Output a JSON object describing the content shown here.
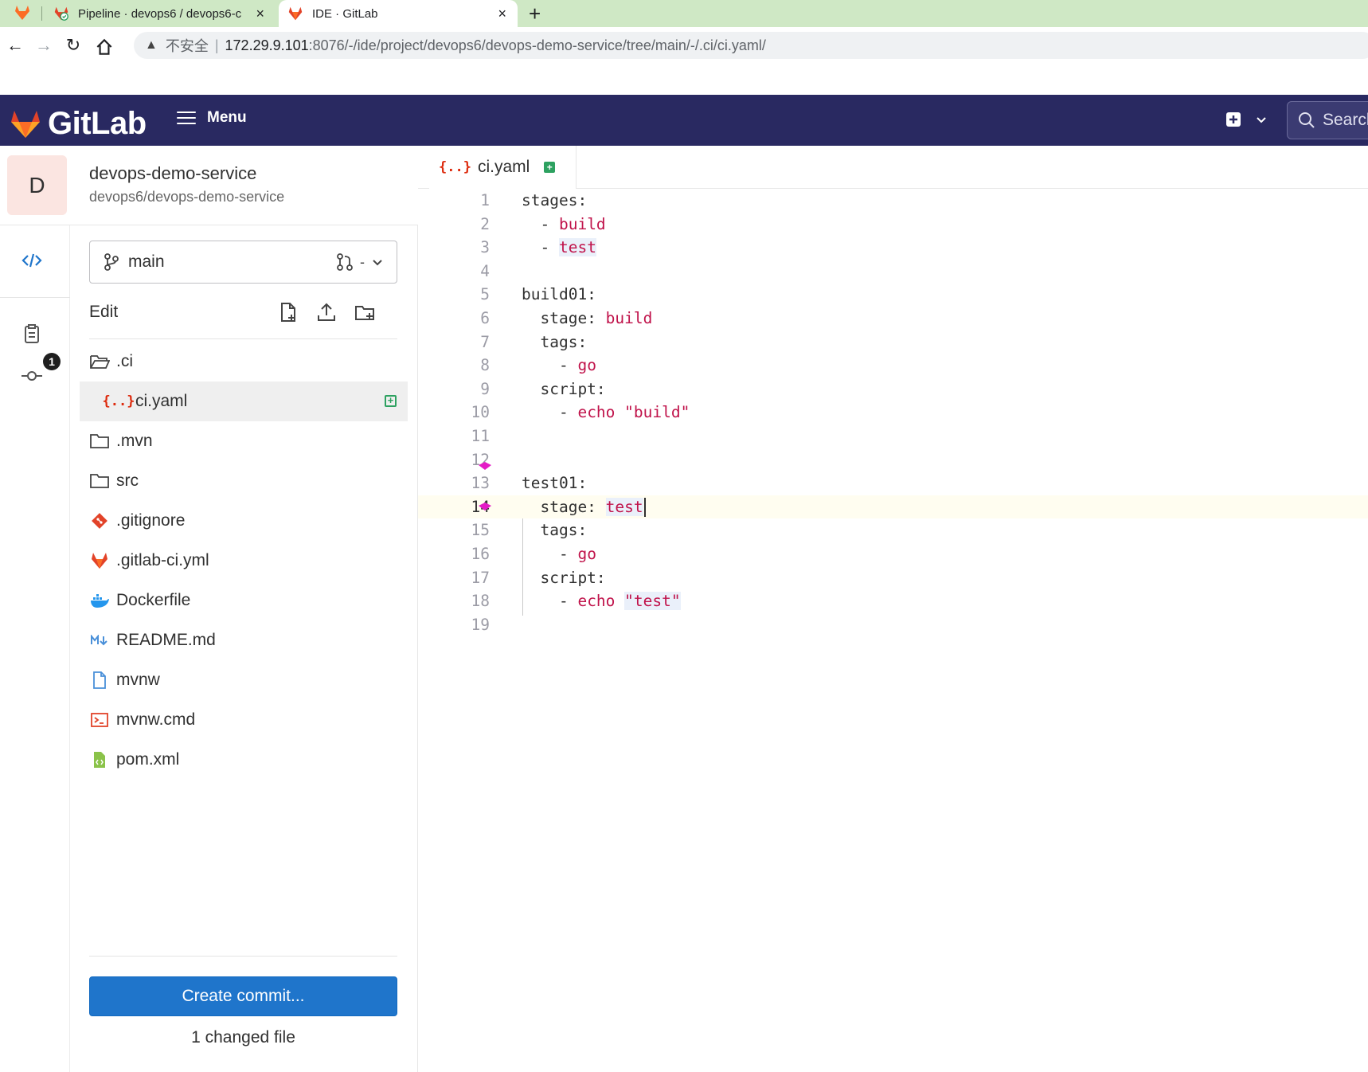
{
  "browser": {
    "tabs": [
      {
        "title": "Pipeline · devops6 / devops6-c",
        "close": "×"
      },
      {
        "title": "IDE · GitLab",
        "close": "×"
      }
    ],
    "new_tab": "+",
    "address": {
      "warning_icon": "warning-triangle-icon",
      "insecure_label": "不安全",
      "separator": "|",
      "host": "172.29.9.101",
      "path": ":8076/-/ide/project/devops6/devops-demo-service/tree/main/-/.ci/ci.yaml/"
    }
  },
  "header": {
    "brand": "GitLab",
    "menu_label": "Menu",
    "search_placeholder": "Search",
    "colors": {
      "background": "#292961",
      "brand_orange": "#e24329"
    }
  },
  "project": {
    "avatar_letter": "D",
    "name": "devops-demo-service",
    "path": "devops6/devops-demo-service"
  },
  "sidebar": {
    "branch": "main",
    "mr_label": "-",
    "edit_label": "Edit",
    "commit_badge": "1",
    "files": [
      {
        "name": ".ci",
        "icon": "folder-open-icon",
        "type": "folder"
      },
      {
        "name": "ci.yaml",
        "icon": "yaml-icon",
        "type": "file",
        "active": true,
        "added": true
      },
      {
        "name": ".mvn",
        "icon": "folder-icon",
        "type": "folder"
      },
      {
        "name": "src",
        "icon": "folder-icon",
        "type": "folder"
      },
      {
        "name": ".gitignore",
        "icon": "git-icon",
        "type": "file"
      },
      {
        "name": ".gitlab-ci.yml",
        "icon": "gitlab-icon",
        "type": "file"
      },
      {
        "name": "Dockerfile",
        "icon": "docker-icon",
        "type": "file"
      },
      {
        "name": "README.md",
        "icon": "markdown-icon",
        "type": "file"
      },
      {
        "name": "mvnw",
        "icon": "file-icon",
        "type": "file"
      },
      {
        "name": "mvnw.cmd",
        "icon": "terminal-icon",
        "type": "file"
      },
      {
        "name": "pom.xml",
        "icon": "xml-icon",
        "type": "file"
      }
    ],
    "create_commit_label": "Create commit...",
    "changed_files_label": "1 changed file"
  },
  "editor": {
    "tab_label": "ci.yaml",
    "yaml_glyph": "{..}",
    "added_glyph": "+",
    "lines": [
      {
        "n": "1",
        "text": "stages:"
      },
      {
        "n": "2",
        "text": "  - build"
      },
      {
        "n": "3",
        "text": "  - test"
      },
      {
        "n": "4",
        "text": ""
      },
      {
        "n": "5",
        "text": "build01:"
      },
      {
        "n": "6",
        "text": "  stage: build"
      },
      {
        "n": "7",
        "text": "  tags:"
      },
      {
        "n": "8",
        "text": "    - go"
      },
      {
        "n": "9",
        "text": "  script:"
      },
      {
        "n": "10",
        "text": "    - echo \"build\""
      },
      {
        "n": "11",
        "text": ""
      },
      {
        "n": "12",
        "text": ""
      },
      {
        "n": "13",
        "text": "test01:"
      },
      {
        "n": "14",
        "text": "  stage: test"
      },
      {
        "n": "15",
        "text": "  tags:"
      },
      {
        "n": "16",
        "text": "    - go"
      },
      {
        "n": "17",
        "text": "  script:"
      },
      {
        "n": "18",
        "text": "    - echo \"test\""
      },
      {
        "n": "19",
        "text": ""
      }
    ],
    "current_line": "14"
  }
}
